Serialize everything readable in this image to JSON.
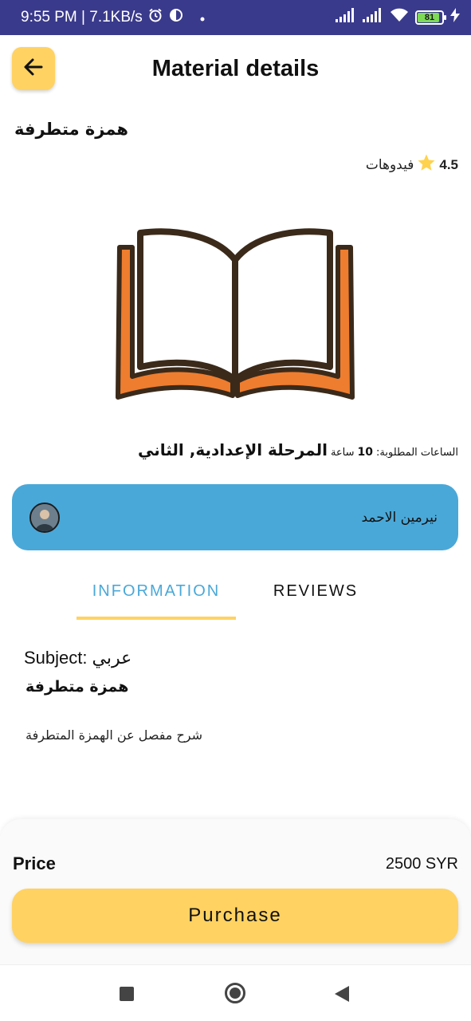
{
  "status_bar": {
    "time_speed": "9:55 PM | 7.1KB/s",
    "battery": "81"
  },
  "header": {
    "title": "Material details"
  },
  "material": {
    "name": "همزة متطرفة",
    "rating": "4.5",
    "videos_label": "فيدوهات",
    "hours_label": "الساعات المطلوبة:",
    "hours_value": "10",
    "hours_unit": "ساعة",
    "level": "المرحلة الإعدادية, الثاني"
  },
  "teacher": {
    "name": "نيرمين الاحمد"
  },
  "tabs": [
    {
      "label": "INFORMATION",
      "active": true
    },
    {
      "label": "REVIEWS",
      "active": false
    }
  ],
  "information": {
    "subject_label": "Subject:",
    "subject_value": "عربي",
    "title": "همزة متطرفة",
    "description": "شرح مفصل عن الهمزة المتطرفة"
  },
  "purchase": {
    "price_label": "Price",
    "price_value": "2500 SYR",
    "button_label": "Purchase"
  },
  "colors": {
    "accent_yellow": "#ffd262",
    "teacher_card_blue": "#4aa8d8",
    "status_bar": "#3a3a8c",
    "book_orange": "#ee7d2f"
  }
}
